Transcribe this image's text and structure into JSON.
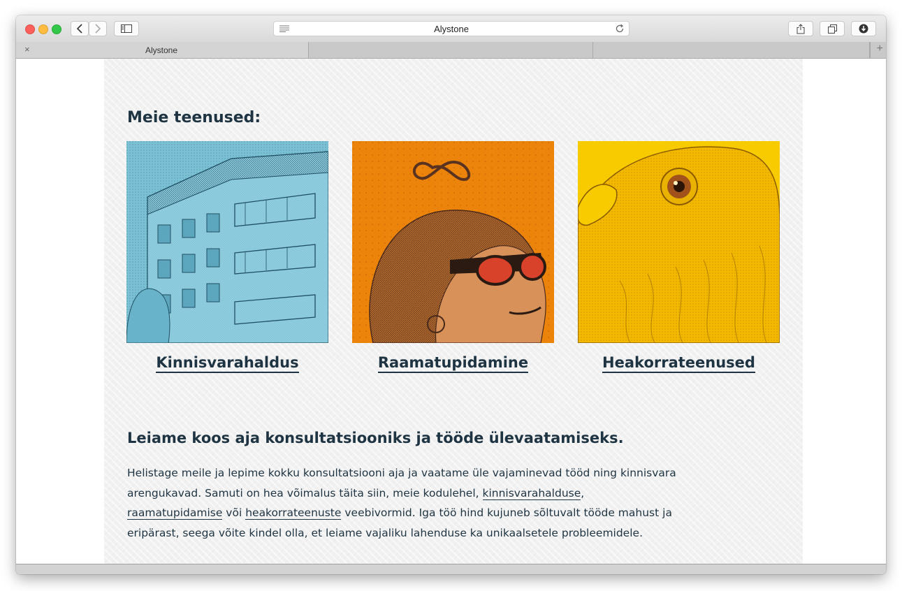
{
  "browser": {
    "url_text": "Alystone",
    "tabs": [
      {
        "label": "Alystone",
        "active": true
      },
      {
        "label": "",
        "active": false
      },
      {
        "label": "",
        "active": false
      }
    ],
    "new_tab_symbol": "+",
    "close_tab_symbol": "×"
  },
  "page": {
    "services_heading": "Meie teenused:",
    "services": [
      {
        "label": "Kinnisvarahaldus",
        "image": "building-illustration",
        "color": "#7ec4d8"
      },
      {
        "label": "Raamatupidamine",
        "image": "woman-sunglasses-illustration",
        "color": "#ec840c"
      },
      {
        "label": "Heakorrateenused",
        "image": "pigeon-illustration",
        "color": "#f7cb00"
      }
    ],
    "consult_heading": "Leiame koos aja konsultatsiooniks ja tööde ülevaatamiseks.",
    "body": {
      "part1": "Helistage meile ja lepime kokku konsultatsiooni aja ja vaatame üle vajaminevad tööd ning kinnisvara arengukavad. Samuti on hea võimalus täita siin, meie kodulehel, ",
      "link1": "kinnisvarahalduse",
      "part2": ", ",
      "link2": "raamatupidamise",
      "part3": " või ",
      "link3": "heakorrateenuste",
      "part4": " veebivormid. Iga töö hind kujuneb sõltuvalt tööde mahust ja eripärast, seega võite kindel olla, et leiame vajaliku lahenduse ka unikaalsetele probleemidele."
    }
  },
  "colors": {
    "text": "#1f3442",
    "page_bg": "#f1f1f1"
  }
}
